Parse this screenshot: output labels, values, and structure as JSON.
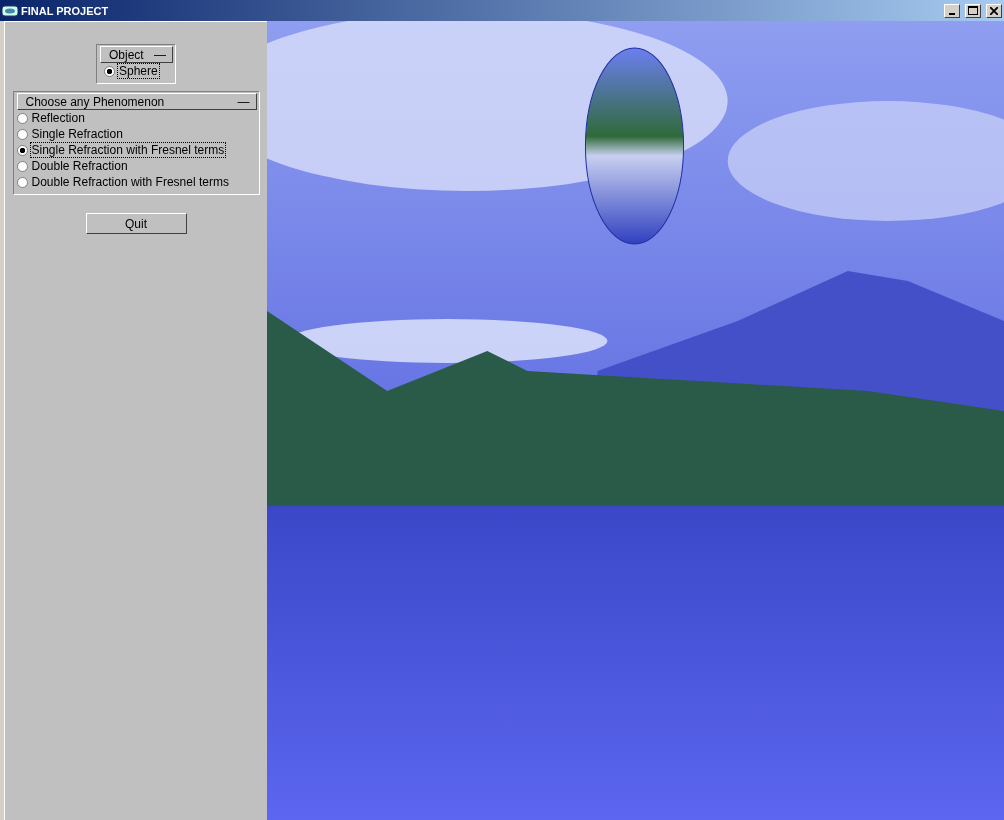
{
  "window": {
    "title": "FINAL PROJECT"
  },
  "object_panel": {
    "title": "Object",
    "collapse": "—",
    "options": [
      {
        "label": "Sphere",
        "selected": true
      }
    ]
  },
  "phenomenon_panel": {
    "title": "Choose any Phenomenon",
    "collapse": "—",
    "options": [
      {
        "label": "Reflection",
        "selected": false
      },
      {
        "label": "Single Refraction",
        "selected": false
      },
      {
        "label": "Single Refraction with Fresnel terms",
        "selected": true
      },
      {
        "label": "Double Refraction",
        "selected": false
      },
      {
        "label": "Double Refraction with Fresnel terms",
        "selected": false
      }
    ]
  },
  "quit_button": "Quit"
}
